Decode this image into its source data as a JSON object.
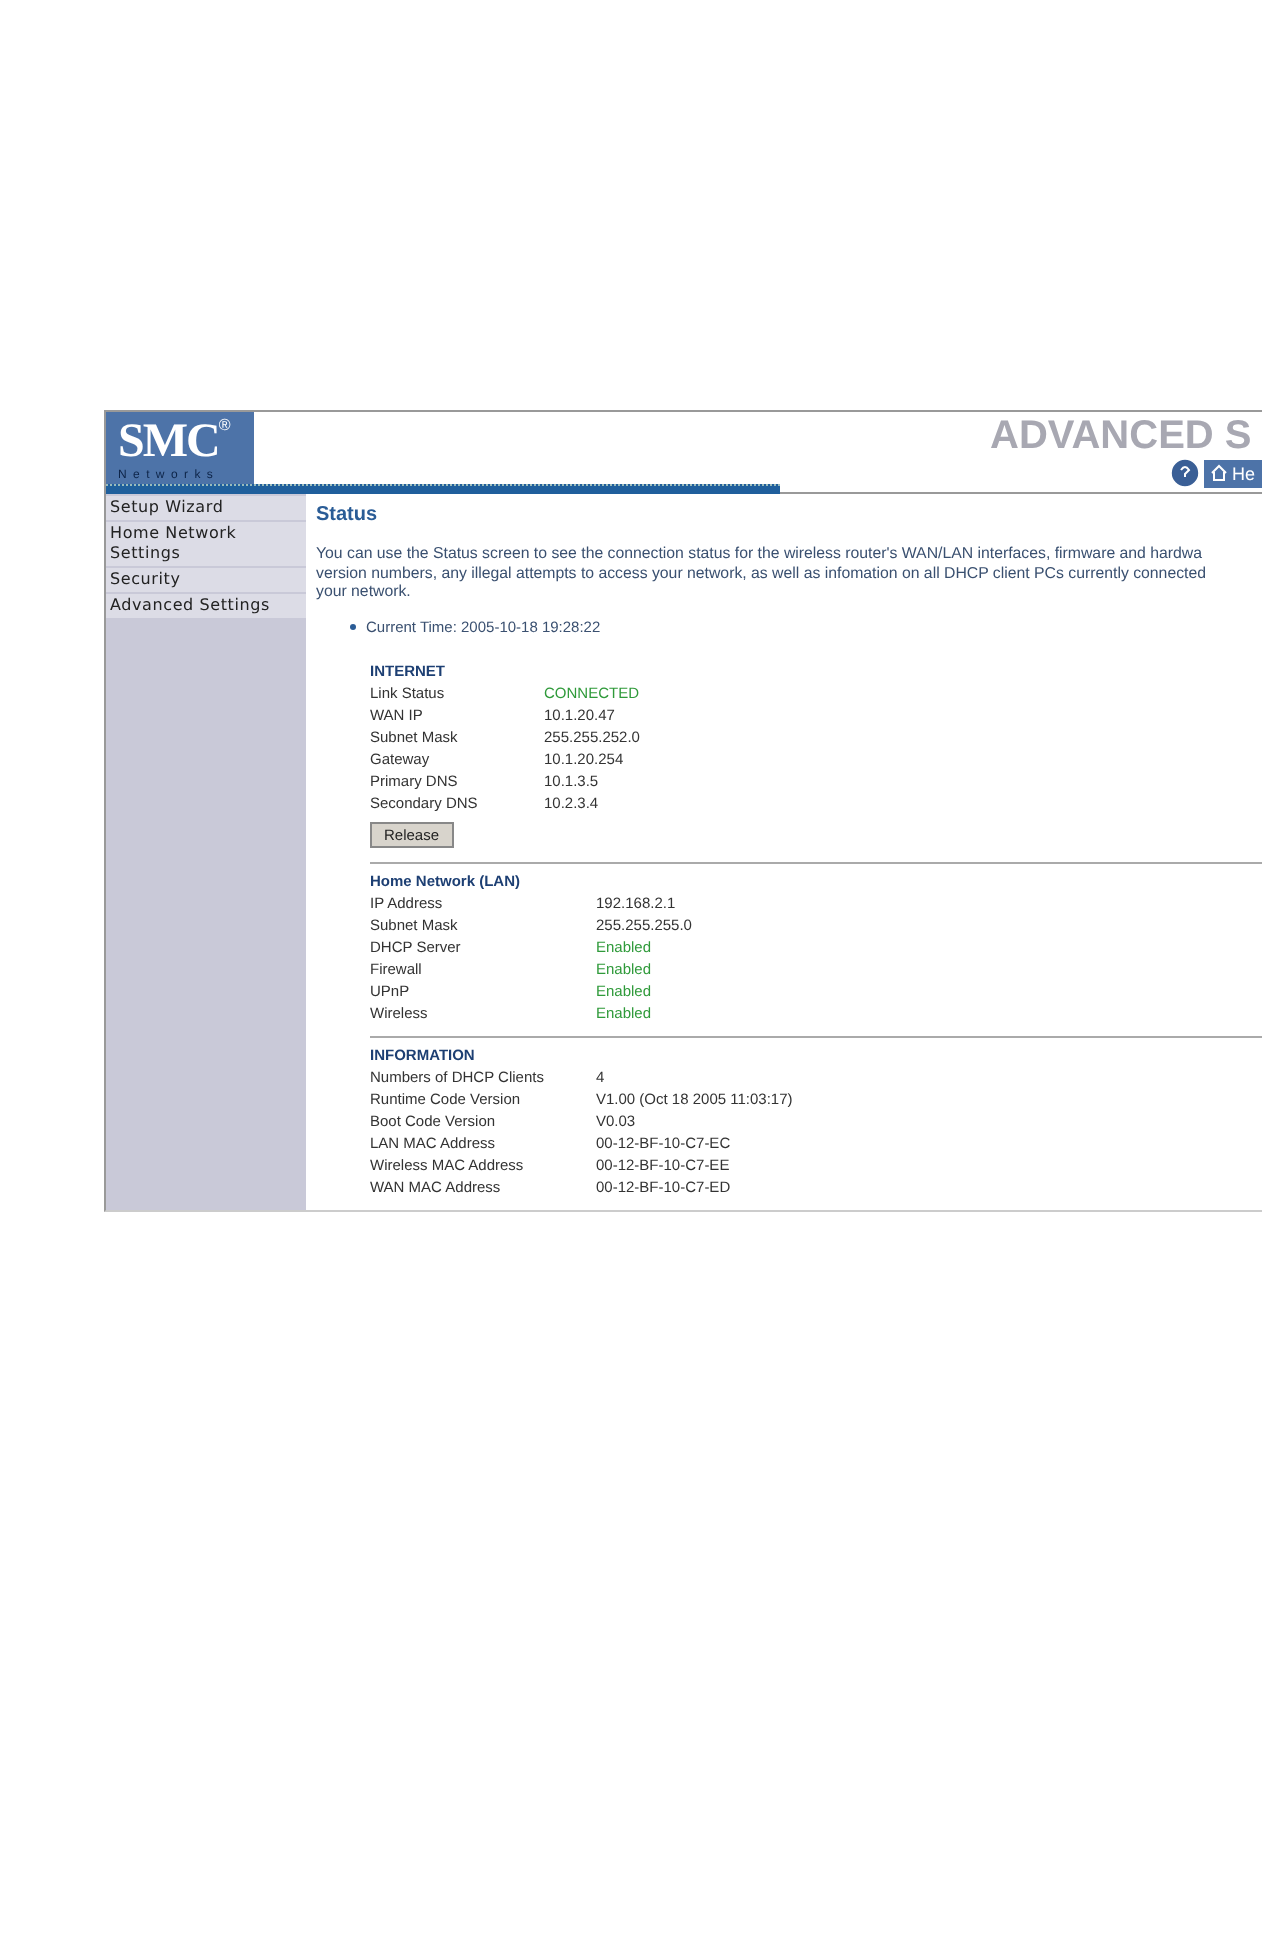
{
  "logo": {
    "brand": "SMC",
    "mark": "®",
    "tagline": "Networks"
  },
  "header": {
    "banner": "ADVANCED S",
    "help_tab": "He"
  },
  "sidebar": {
    "items": [
      {
        "label": "Setup Wizard",
        "selected": false
      },
      {
        "label": "Home Network Settings",
        "selected": false
      },
      {
        "label": "Security",
        "selected": false
      },
      {
        "label": "Advanced Settings",
        "selected": false
      }
    ]
  },
  "page": {
    "title": "Status",
    "intro_lines": [
      "You can use the Status screen to see the connection status for the wireless router's WAN/LAN interfaces, firmware and hardwa",
      "version numbers, any illegal attempts to access your network, as well as infomation on all DHCP client PCs currently connected",
      "your network."
    ],
    "current_time": "Current Time: 2005-10-18 19:28:22",
    "sections": [
      {
        "title": "INTERNET",
        "rows": [
          {
            "label": "Link Status",
            "value": "CONNECTED",
            "kind": "status"
          },
          {
            "label": "WAN IP",
            "value": "10.1.20.47",
            "kind": "text"
          },
          {
            "label": "Subnet Mask",
            "value": "255.255.252.0",
            "kind": "text"
          },
          {
            "label": "Gateway",
            "value": "10.1.20.254",
            "kind": "text"
          },
          {
            "label": "Primary DNS",
            "value": "10.1.3.5",
            "kind": "text"
          },
          {
            "label": "Secondary DNS",
            "value": "10.2.3.4",
            "kind": "text"
          }
        ],
        "button": "Release"
      },
      {
        "title": "Home Network (LAN)",
        "rows": [
          {
            "label": "IP Address",
            "value": "192.168.2.1",
            "kind": "text"
          },
          {
            "label": "Subnet Mask",
            "value": "255.255.255.0",
            "kind": "text"
          },
          {
            "label": "DHCP Server",
            "value": "Enabled",
            "kind": "status"
          },
          {
            "label": "Firewall",
            "value": "Enabled",
            "kind": "status"
          },
          {
            "label": "UPnP",
            "value": "Enabled",
            "kind": "status"
          },
          {
            "label": "Wireless",
            "value": "Enabled",
            "kind": "status"
          }
        ]
      },
      {
        "title": "INFORMATION",
        "rows": [
          {
            "label": "Numbers of DHCP Clients",
            "value": "4",
            "kind": "text"
          },
          {
            "label": "Runtime Code Version",
            "value": "V1.00 (Oct 18 2005 11:03:17)",
            "kind": "text"
          },
          {
            "label": "Boot Code Version",
            "value": "V0.03",
            "kind": "text"
          },
          {
            "label": "LAN MAC Address",
            "value": "00-12-BF-10-C7-EC",
            "kind": "text"
          },
          {
            "label": "Wireless MAC Address",
            "value": "00-12-BF-10-C7-EE",
            "kind": "text"
          },
          {
            "label": "WAN MAC Address",
            "value": "00-12-BF-10-C7-ED",
            "kind": "text"
          }
        ]
      }
    ]
  }
}
